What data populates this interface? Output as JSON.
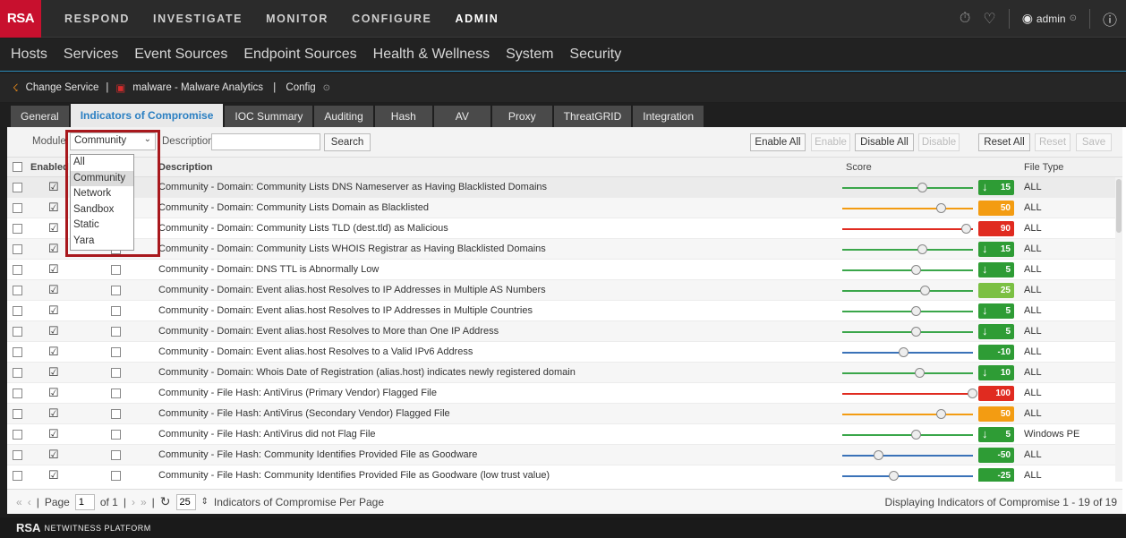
{
  "topnav": {
    "logo": "RSA",
    "items": [
      "RESPOND",
      "INVESTIGATE",
      "MONITOR",
      "CONFIGURE",
      "ADMIN"
    ],
    "active": "ADMIN",
    "user": "admin"
  },
  "subnav": {
    "items": [
      "Hosts",
      "Services",
      "Event Sources",
      "Endpoint Sources",
      "Health & Wellness",
      "System",
      "Security"
    ]
  },
  "servbar": {
    "change_service": "Change Service",
    "service": "malware - Malware Analytics",
    "config": "Config"
  },
  "tabs": [
    "General",
    "Indicators of Compromise",
    "IOC Summary",
    "Auditing",
    "Hash",
    "AV",
    "Proxy",
    "ThreatGRID",
    "Integration"
  ],
  "active_tab": "Indicators of Compromise",
  "toolbar": {
    "module_label": "Module",
    "module_value": "Community",
    "description_label": "Description",
    "description_value": "",
    "search": "Search",
    "enable_all": "Enable All",
    "enable": "Enable",
    "disable_all": "Disable All",
    "disable": "Disable",
    "reset_all": "Reset All",
    "reset": "Reset",
    "save": "Save"
  },
  "table": {
    "columns": {
      "enabled": "Enabled",
      "description": "Description",
      "score": "Score",
      "file_type": "File Type"
    },
    "rows": [
      {
        "description": "Community - Domain: Community Lists DNS Nameserver as Having Blacklisted Domains",
        "score": "15",
        "score_level": 0.6,
        "color": "#2e9c35",
        "slider_color": "#3aa64a",
        "down": true,
        "file_type": "ALL"
      },
      {
        "description": "Community - Domain: Community Lists Domain as Blacklisted",
        "score": "50",
        "score_level": 0.75,
        "color": "#f39c12",
        "slider_color": "#f39c12",
        "down": false,
        "file_type": "ALL"
      },
      {
        "description": "Community - Domain: Community Lists TLD (dest.tld) as Malicious",
        "score": "90",
        "score_level": 0.95,
        "color": "#e02b20",
        "slider_color": "#e02b20",
        "down": false,
        "file_type": "ALL"
      },
      {
        "description": "Community - Domain: Community Lists WHOIS Registrar as Having Blacklisted Domains",
        "score": "15",
        "score_level": 0.6,
        "color": "#2e9c35",
        "slider_color": "#3aa64a",
        "down": true,
        "file_type": "ALL"
      },
      {
        "description": "Community - Domain: DNS TTL is Abnormally Low",
        "score": "5",
        "score_level": 0.55,
        "color": "#2e9c35",
        "slider_color": "#3aa64a",
        "down": true,
        "file_type": "ALL"
      },
      {
        "description": "Community - Domain: Event alias.host Resolves to IP Addresses in Multiple AS Numbers",
        "score": "25",
        "score_level": 0.62,
        "color": "#7bc043",
        "slider_color": "#3aa64a",
        "down": false,
        "file_type": "ALL"
      },
      {
        "description": "Community - Domain: Event alias.host Resolves to IP Addresses in Multiple Countries",
        "score": "5",
        "score_level": 0.55,
        "color": "#2e9c35",
        "slider_color": "#3aa64a",
        "down": true,
        "file_type": "ALL"
      },
      {
        "description": "Community - Domain: Event alias.host Resolves to More than One IP Address",
        "score": "5",
        "score_level": 0.55,
        "color": "#2e9c35",
        "slider_color": "#3aa64a",
        "down": true,
        "file_type": "ALL"
      },
      {
        "description": "Community - Domain: Event alias.host Resolves to a Valid IPv6 Address",
        "score": "-10",
        "score_level": 0.45,
        "color": "#2e9c35",
        "slider_color": "#3a72b8",
        "down": false,
        "file_type": "ALL"
      },
      {
        "description": "Community - Domain: Whois Date of Registration (alias.host) indicates newly registered domain",
        "score": "10",
        "score_level": 0.58,
        "color": "#2e9c35",
        "slider_color": "#3aa64a",
        "down": true,
        "file_type": "ALL"
      },
      {
        "description": "Community - File Hash: AntiVirus (Primary Vendor) Flagged File",
        "score": "100",
        "score_level": 1.0,
        "color": "#e02b20",
        "slider_color": "#e02b20",
        "down": false,
        "file_type": "ALL"
      },
      {
        "description": "Community - File Hash: AntiVirus (Secondary Vendor) Flagged File",
        "score": "50",
        "score_level": 0.75,
        "color": "#f39c12",
        "slider_color": "#f39c12",
        "down": false,
        "file_type": "ALL"
      },
      {
        "description": "Community - File Hash: AntiVirus did not Flag File",
        "score": "5",
        "score_level": 0.55,
        "color": "#2e9c35",
        "slider_color": "#3aa64a",
        "down": true,
        "file_type": "Windows PE"
      },
      {
        "description": "Community - File Hash: Community Identifies Provided File as Goodware",
        "score": "-50",
        "score_level": 0.25,
        "color": "#2e9c35",
        "slider_color": "#3a72b8",
        "down": false,
        "file_type": "ALL"
      },
      {
        "description": "Community - File Hash: Community Identifies Provided File as Goodware (low trust value)",
        "score": "-25",
        "score_level": 0.37,
        "color": "#2e9c35",
        "slider_color": "#3a72b8",
        "down": false,
        "file_type": "ALL"
      }
    ]
  },
  "pager": {
    "page_label": "Page",
    "page_value": "1",
    "of_label": "of 1",
    "per_page_value": "25",
    "per_page_label": "Indicators of Compromise Per Page",
    "summary": "Displaying Indicators of Compromise 1 - 19 of 19"
  },
  "dropdown": {
    "options": [
      "All",
      "Community",
      "Network",
      "Sandbox",
      "Static",
      "Yara"
    ],
    "selected": "Community"
  },
  "footer": {
    "brand": "RSA",
    "platform": "NETWITNESS PLATFORM"
  }
}
